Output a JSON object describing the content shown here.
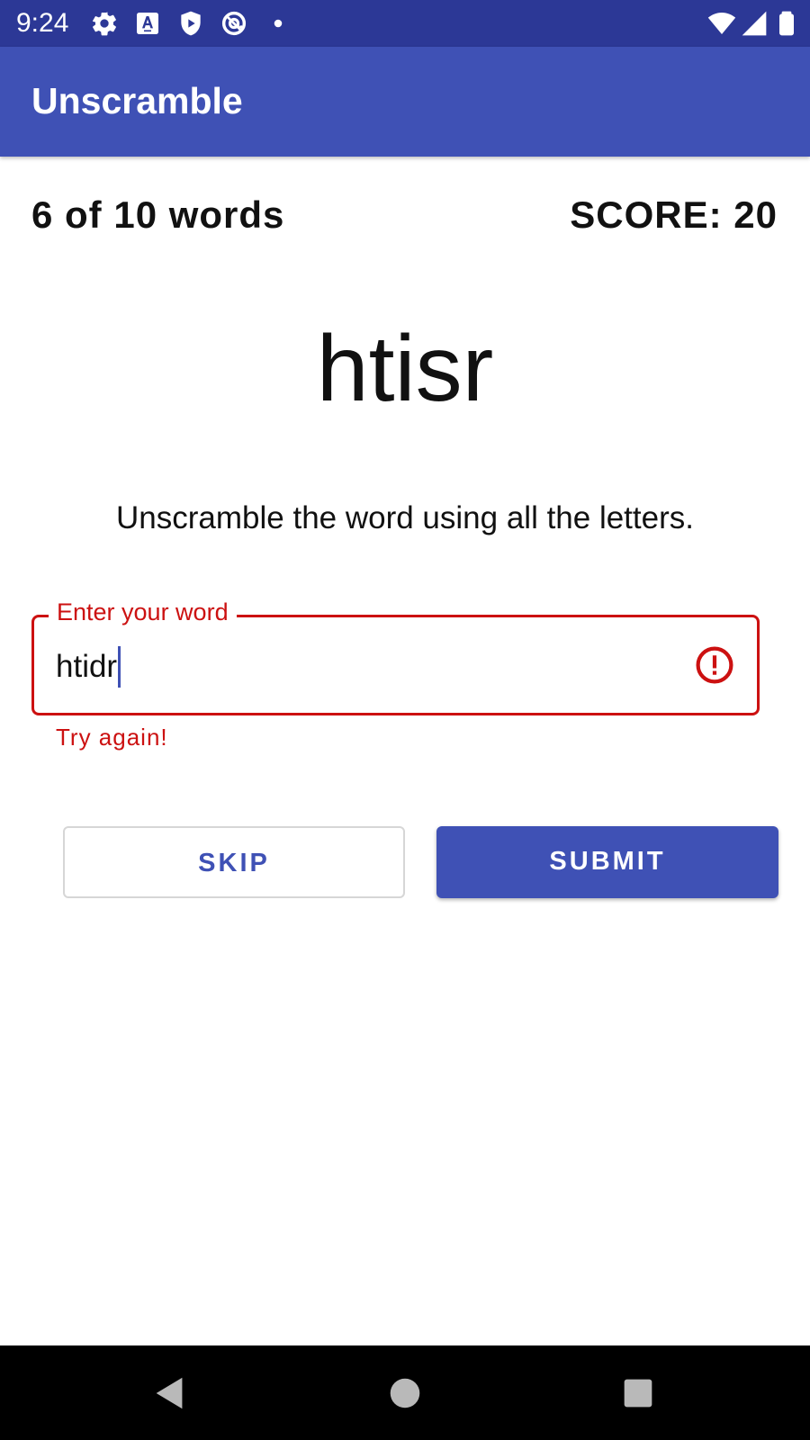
{
  "status_bar": {
    "time": "9:24",
    "left_icons": [
      "gear-icon",
      "font-a-icon",
      "shield-play-icon",
      "at-sign-icon",
      "dot-icon"
    ],
    "right_icons": [
      "wifi-icon",
      "signal-icon",
      "battery-icon"
    ]
  },
  "app_bar": {
    "title": "Unscramble"
  },
  "game": {
    "word_count": "6 of 10 words",
    "score": "SCORE: 20",
    "scrambled_word": "htisr",
    "instructions": "Unscramble the word using all the letters."
  },
  "input": {
    "label": "Enter your word",
    "value": "htidr",
    "error_text": "Try again!"
  },
  "buttons": {
    "skip_label": "SKIP",
    "submit_label": "SUBMIT"
  },
  "colors": {
    "primary": "#3f51b5",
    "status_bar": "#2c3896",
    "error": "#cc1111"
  },
  "nav_bar": {
    "icons": [
      "back-icon",
      "home-icon",
      "recents-icon"
    ]
  }
}
